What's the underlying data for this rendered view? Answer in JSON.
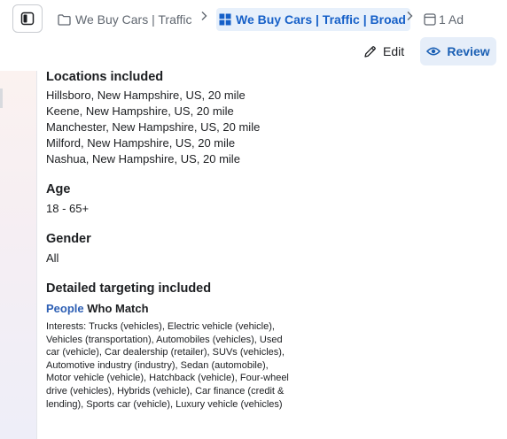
{
  "breadcrumb": {
    "campaign": "We Buy Cars | Traffic",
    "ad_set": "We Buy Cars | Traffic | Broad",
    "ads": "1 Ad"
  },
  "actions": {
    "edit_label": "Edit",
    "review_label": "Review"
  },
  "icons": {
    "panel": "sidebar-toggle-icon",
    "campaign": "folder-icon",
    "ad_set": "grid-icon",
    "ads": "ad-icon",
    "edit": "pencil-icon",
    "review": "eye-icon"
  },
  "colors": {
    "accent": "#1660c8",
    "active_crumb_bg": "#e7f0fb",
    "review_bg": "#e6eef9"
  },
  "targeting": {
    "locations_heading": "Locations included",
    "locations": [
      "Hillsboro, New Hampshire, US, 20 mile",
      "Keene, New Hampshire, US, 20 mile",
      "Manchester, New Hampshire, US, 20 mile",
      "Milford, New Hampshire, US, 20 mile",
      "Nashua, New Hampshire, US, 20 mile"
    ],
    "age_heading": "Age",
    "age_value": "18 - 65+",
    "gender_heading": "Gender",
    "gender_value": "All",
    "detailed_heading": "Detailed targeting included",
    "people_word": "People",
    "who_match": " Who Match",
    "interests": "Interests: Trucks (vehicles), Electric vehicle (vehicle), Vehicles (transportation), Automobiles (vehicles), Used car (vehicle), Car dealership (retailer), SUVs (vehicles), Automotive industry (industry), Sedan (automobile), Motor vehicle (vehicle), Hatchback (vehicle), Four-wheel drive (vehicles), Hybrids (vehicle), Car finance (credit & lending), Sports car (vehicle), Luxury vehicle (vehicles)"
  }
}
